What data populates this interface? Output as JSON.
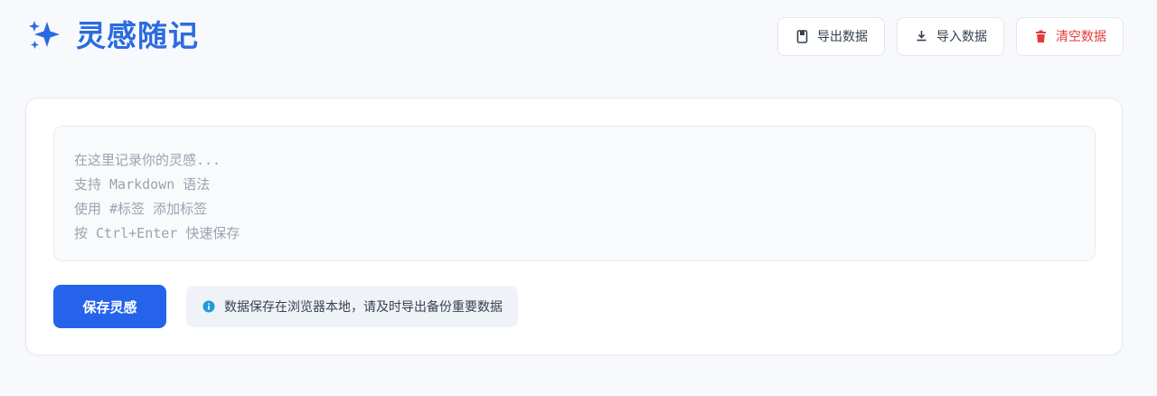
{
  "app": {
    "title": "灵感随记",
    "logo_icon": "sparkles-icon",
    "accent_color": "#2b6be0"
  },
  "toolbar": {
    "export_label": "导出数据",
    "export_icon": "save-file-icon",
    "import_label": "导入数据",
    "import_icon": "download-icon",
    "clear_label": "清空数据",
    "clear_icon": "trash-icon",
    "clear_color": "#e23b3b"
  },
  "editor": {
    "value": "",
    "placeholder": "在这里记录你的灵感...\n支持 Markdown 语法\n使用 #标签 添加标签\n按 Ctrl+Enter 快速保存"
  },
  "actions": {
    "save_label": "保存灵感",
    "save_color": "#2563eb"
  },
  "notice": {
    "icon": "info-icon",
    "text": "数据保存在浏览器本地，请及时导出备份重要数据"
  }
}
